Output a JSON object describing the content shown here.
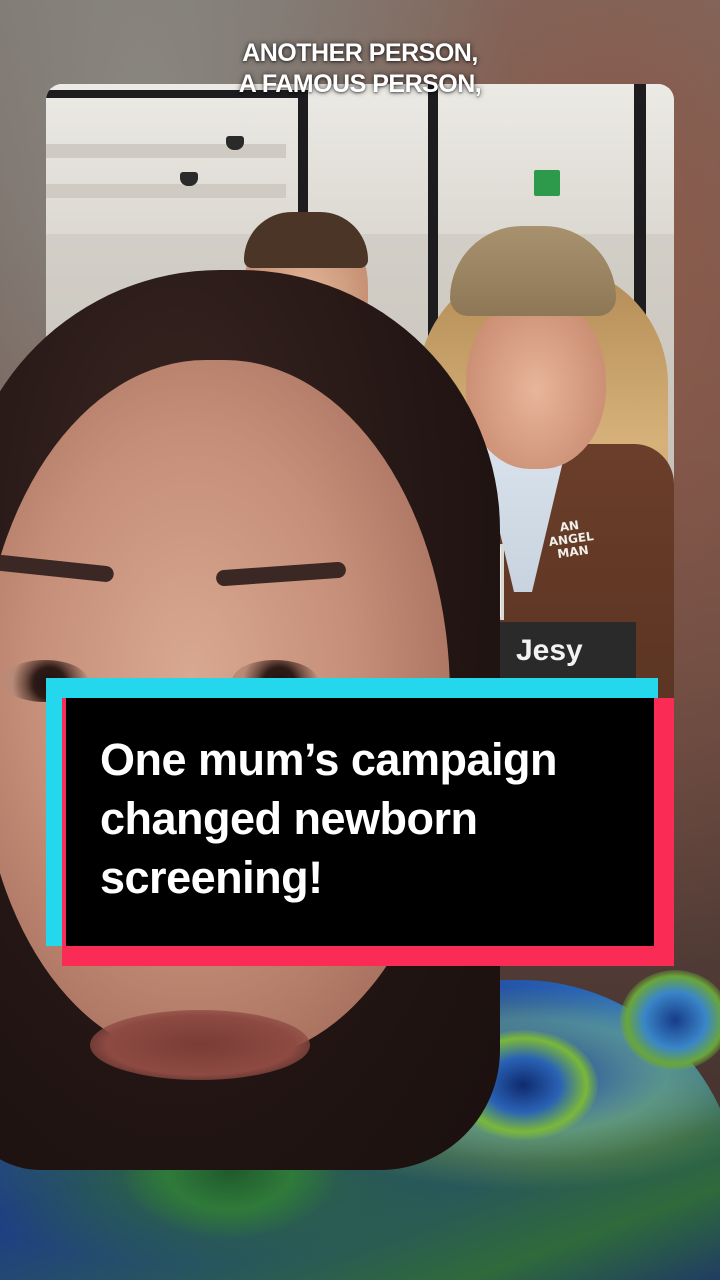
{
  "caption": {
    "line1": "ANOTHER PERSON,",
    "line2": "A FAMOUS PERSON,"
  },
  "photo": {
    "cardigan_logo": "AN ANGEL MAN",
    "sign_text": "Jesy"
  },
  "headline": {
    "line1": "One mum’s campaign",
    "line2": "changed newborn",
    "line3": "screening!"
  },
  "colors": {
    "headline_cyan": "#25d7ec",
    "headline_red": "#fa2c55",
    "headline_bg": "#000000",
    "text": "#ffffff"
  }
}
